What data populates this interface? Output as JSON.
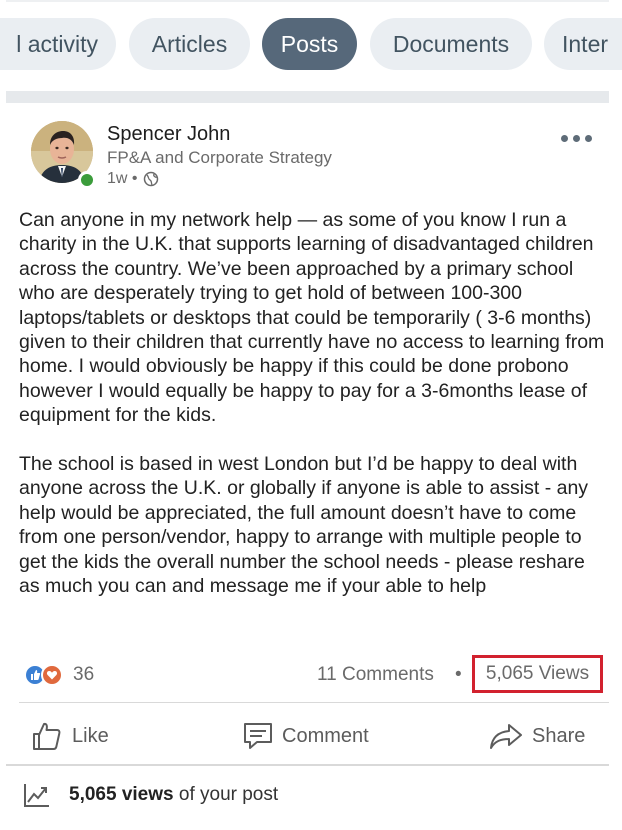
{
  "tabs": [
    {
      "label": "l activity",
      "active": false
    },
    {
      "label": "Articles",
      "active": false
    },
    {
      "label": "Posts",
      "active": true
    },
    {
      "label": "Documents",
      "active": false
    },
    {
      "label": "Inter",
      "active": false
    }
  ],
  "post": {
    "author": {
      "name": "Spencer John",
      "headline": "FP&A and Corporate Strategy",
      "time": "1w •",
      "online": true
    },
    "paragraphs": [
      "Can anyone in my network help — as some of you know I run a charity in the U.K. that supports learning of disadvantaged children across the country. We’ve been approached by a primary school who are desperately trying to get hold of between 100-300 laptops/tablets or desktops that could be temporarily ( 3-6 months) given to their children that currently have no access to learning from home. I would obviously be happy if this could be done probono however I would equally be happy to pay for a 3-6months lease of equipment for the kids.",
      "The school is based in west London but I’d be happy to deal with anyone across the U.K. or globally if anyone is able to assist - any help would be appreciated, the full amount doesn’t have to come from one person/vendor, happy to arrange with multiple people to get the kids the overall number the school needs - please reshare as much you can and message me if your able to help"
    ],
    "reactions_count": "36",
    "comments": "11 Comments",
    "separator": "•",
    "views": "5,065 Views",
    "views_highlight_color": "#d2212e"
  },
  "actions": {
    "like": "Like",
    "comment": "Comment",
    "share": "Share"
  },
  "footer": {
    "views_bold": "5,065 views",
    "views_rest": " of your post"
  },
  "colors": {
    "active_tab": "#56687a",
    "inactive_tab": "#eaeef2",
    "like_blue": "#3b80d4",
    "love_orange": "#e0693d",
    "presence_green": "#3b9c3b"
  }
}
